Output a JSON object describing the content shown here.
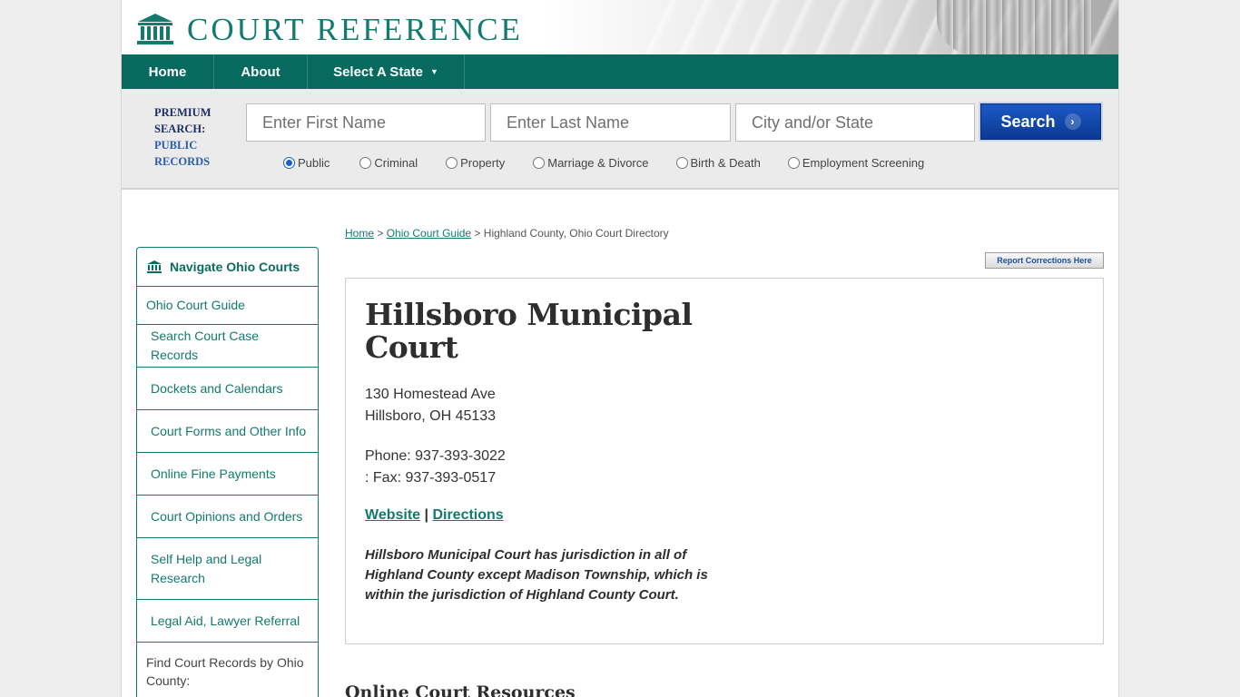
{
  "header": {
    "logo_text": "COURT REFERENCE"
  },
  "nav": {
    "home": "Home",
    "about": "About",
    "select_state": "Select A State",
    "select_state_caret": "▼"
  },
  "search": {
    "premium_line1": "PREMIUM SEARCH:",
    "premium_line2": "PUBLIC RECORDS",
    "first_name_placeholder": "Enter First Name",
    "last_name_placeholder": "Enter Last Name",
    "city_placeholder": "City and/or State",
    "button_label": "Search",
    "button_chevron": "›",
    "radio_options": [
      "Public",
      "Criminal",
      "Property",
      "Marriage & Divorce",
      "Birth & Death",
      "Employment Screening"
    ],
    "selected": "Public"
  },
  "sidebar": {
    "title": "Navigate Ohio Courts",
    "items": [
      "Ohio Court Guide",
      "Search Court Case Records",
      "Dockets and Calendars",
      "Court Forms and Other Info",
      "Online Fine Payments",
      "Court Opinions and Orders",
      "Self Help and Legal Research",
      "Legal Aid, Lawyer Referral"
    ],
    "footer_text": "Find Court Records by Ohio County:"
  },
  "breadcrumb": {
    "home": "Home",
    "sep1": " > ",
    "guide": "Ohio Court Guide",
    "sep2": " > ",
    "current": "Highland County, Ohio Court Directory"
  },
  "report_button": "Report Corrections Here",
  "court": {
    "name": "Hillsboro Municipal Court",
    "address_line1": "130 Homestead Ave",
    "address_line2": "Hillsboro, OH 45133",
    "phone": "Phone: 937-393-3022",
    "fax": ": Fax: 937-393-0517",
    "website_label": "Website",
    "link_separator": " | ",
    "directions_label": "Directions",
    "jurisdiction": "Hillsboro Municipal Court has jurisdiction in all of Highland County except Madison Township, which is within the jurisdiction of Highland County Court."
  },
  "next_section_title": "Online Court Resources"
}
